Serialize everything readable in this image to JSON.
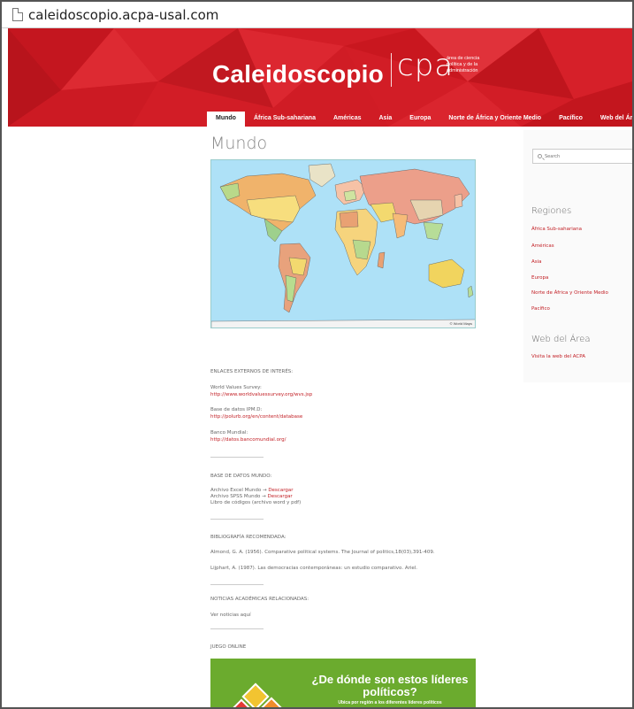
{
  "browser": {
    "url": "caleidoscopio.acpa-usal.com"
  },
  "header": {
    "brand": "Caleidoscopio",
    "cpa": "cpa",
    "cpa_sub_1": "área de ciencia",
    "cpa_sub_2": "política y de la",
    "cpa_sub_3": "administración",
    "colors": {
      "red": "#d21d26"
    }
  },
  "nav": {
    "items": [
      "Mundo",
      "África Sub-sahariana",
      "Américas",
      "Asia",
      "Europa",
      "Norte de África y Oriente Medio",
      "Pacífico",
      "Web del Área"
    ],
    "active": "Mundo"
  },
  "main": {
    "title": "Mundo",
    "map_credit": "© World Maps",
    "links_heading": "ENLACES EXTERNOS DE INTERÉS:",
    "links": [
      {
        "label": "World Values Survey:",
        "url": "http://www.worldvaluessurvey.org/wvs.jsp"
      },
      {
        "label": "Base de datos IPM.D:",
        "url": "http://polurb.org/en/content/database"
      },
      {
        "label": "Banco Mundial:",
        "url": "http://datos.bancomundial.org/"
      }
    ],
    "db_heading": "BASE DE DATOS MUNDO:",
    "db_items": [
      {
        "text": "Archivo Excel Mundo → ",
        "link": "Descargar"
      },
      {
        "text": "Archivo SPSS Mundo → ",
        "link": "Descargar"
      },
      {
        "text": "Libro de códigos (archivo word y pdf)",
        "link": ""
      }
    ],
    "biblio_heading": "BIBLIOGRAFÍA RECOMENDADA:",
    "biblio": [
      "Almond, G. A. (1956). Comparative political systems. The Journal of politics,18(03),391-409.",
      "Lijphart, A. (1987). Las democracias contemporáneas: un estudio comparativo. Ariel."
    ],
    "news_heading": "NOTICIAS ACADÉMICAS RELACIONADAS:",
    "news_text": "Ver noticias aquí",
    "game_heading": "JUEGO ONLINE",
    "game": {
      "question": "¿De dónde son estos líderes políticos?",
      "subtitle": "Ubica por región a los diferentes líderes políticos",
      "tiles": [
        "#f2c431",
        "#f08c2b",
        "#e33a35",
        "#2f9fd9"
      ]
    }
  },
  "sidebar": {
    "search_placeholder": "Search",
    "regiones_heading": "Regiones",
    "regiones": [
      "África Sub-sahariana",
      "Américas",
      "Asia",
      "Europa",
      "Norte de África y Oriente Medio",
      "Pacífico"
    ],
    "web_heading": "Web del Área",
    "web_link": "Visita la web del ACPA"
  }
}
